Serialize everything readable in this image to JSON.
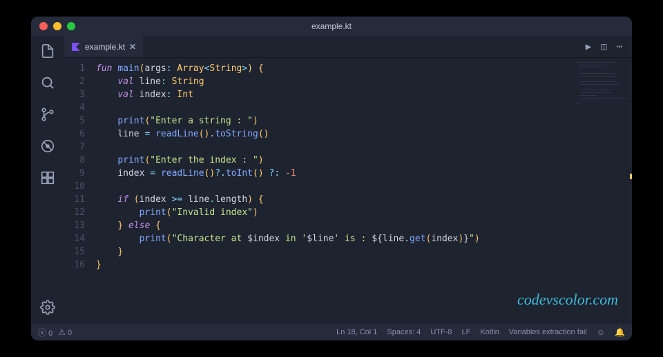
{
  "window": {
    "title": "example.kt"
  },
  "tab": {
    "filename": "example.kt"
  },
  "code": {
    "lines": [
      {
        "n": "1",
        "seg": [
          {
            "c": "kw",
            "t": "fun "
          },
          {
            "c": "fn",
            "t": "main"
          },
          {
            "c": "pn",
            "t": "("
          },
          {
            "c": "id",
            "t": "args"
          },
          {
            "c": "op",
            "t": ": "
          },
          {
            "c": "ty",
            "t": "Array"
          },
          {
            "c": "op",
            "t": "<"
          },
          {
            "c": "ty",
            "t": "String"
          },
          {
            "c": "op",
            "t": ">"
          },
          {
            "c": "pn",
            "t": ") {"
          }
        ]
      },
      {
        "n": "2",
        "seg": [
          {
            "c": "",
            "t": "    "
          },
          {
            "c": "kw",
            "t": "val "
          },
          {
            "c": "id",
            "t": "line"
          },
          {
            "c": "op",
            "t": ": "
          },
          {
            "c": "ty",
            "t": "String"
          }
        ]
      },
      {
        "n": "3",
        "seg": [
          {
            "c": "",
            "t": "    "
          },
          {
            "c": "kw",
            "t": "val "
          },
          {
            "c": "id",
            "t": "index"
          },
          {
            "c": "op",
            "t": ": "
          },
          {
            "c": "ty",
            "t": "Int"
          }
        ]
      },
      {
        "n": "4",
        "seg": []
      },
      {
        "n": "5",
        "seg": [
          {
            "c": "",
            "t": "    "
          },
          {
            "c": "fn",
            "t": "print"
          },
          {
            "c": "pn",
            "t": "("
          },
          {
            "c": "str",
            "t": "\"Enter a string : \""
          },
          {
            "c": "pn",
            "t": ")"
          }
        ]
      },
      {
        "n": "6",
        "seg": [
          {
            "c": "",
            "t": "    "
          },
          {
            "c": "id",
            "t": "line "
          },
          {
            "c": "op",
            "t": "= "
          },
          {
            "c": "fn",
            "t": "readLine"
          },
          {
            "c": "pn",
            "t": "()"
          },
          {
            "c": "op",
            "t": "."
          },
          {
            "c": "fn",
            "t": "toString"
          },
          {
            "c": "pn",
            "t": "()"
          }
        ]
      },
      {
        "n": "7",
        "seg": []
      },
      {
        "n": "8",
        "seg": [
          {
            "c": "",
            "t": "    "
          },
          {
            "c": "fn",
            "t": "print"
          },
          {
            "c": "pn",
            "t": "("
          },
          {
            "c": "str",
            "t": "\"Enter the index : \""
          },
          {
            "c": "pn",
            "t": ")"
          }
        ]
      },
      {
        "n": "9",
        "seg": [
          {
            "c": "",
            "t": "    "
          },
          {
            "c": "id",
            "t": "index "
          },
          {
            "c": "op",
            "t": "= "
          },
          {
            "c": "fn",
            "t": "readLine"
          },
          {
            "c": "pn",
            "t": "()"
          },
          {
            "c": "op",
            "t": "?."
          },
          {
            "c": "fn",
            "t": "toInt"
          },
          {
            "c": "pn",
            "t": "() "
          },
          {
            "c": "op",
            "t": "?: "
          },
          {
            "c": "num",
            "t": "-1"
          }
        ]
      },
      {
        "n": "10",
        "seg": []
      },
      {
        "n": "11",
        "seg": [
          {
            "c": "",
            "t": "    "
          },
          {
            "c": "kw",
            "t": "if "
          },
          {
            "c": "pn",
            "t": "("
          },
          {
            "c": "id",
            "t": "index "
          },
          {
            "c": "op",
            "t": ">= "
          },
          {
            "c": "id",
            "t": "line"
          },
          {
            "c": "op",
            "t": "."
          },
          {
            "c": "id",
            "t": "length"
          },
          {
            "c": "pn",
            "t": ") {"
          }
        ]
      },
      {
        "n": "12",
        "seg": [
          {
            "c": "",
            "t": "        "
          },
          {
            "c": "fn",
            "t": "print"
          },
          {
            "c": "pn",
            "t": "("
          },
          {
            "c": "str",
            "t": "\"Invalid index\""
          },
          {
            "c": "pn",
            "t": ")"
          }
        ]
      },
      {
        "n": "13",
        "seg": [
          {
            "c": "",
            "t": "    "
          },
          {
            "c": "pn",
            "t": "} "
          },
          {
            "c": "kw",
            "t": "else "
          },
          {
            "c": "pn",
            "t": "{"
          }
        ]
      },
      {
        "n": "14",
        "seg": [
          {
            "c": "",
            "t": "        "
          },
          {
            "c": "fn",
            "t": "print"
          },
          {
            "c": "pn",
            "t": "("
          },
          {
            "c": "str",
            "t": "\"Character at "
          },
          {
            "c": "interp",
            "t": "$index"
          },
          {
            "c": "str",
            "t": " in '"
          },
          {
            "c": "interp",
            "t": "$line"
          },
          {
            "c": "str",
            "t": "' is : "
          },
          {
            "c": "interp",
            "t": "${"
          },
          {
            "c": "id",
            "t": "line"
          },
          {
            "c": "op",
            "t": "."
          },
          {
            "c": "fn",
            "t": "get"
          },
          {
            "c": "pn",
            "t": "("
          },
          {
            "c": "id",
            "t": "index"
          },
          {
            "c": "pn",
            "t": ")"
          },
          {
            "c": "interp",
            "t": "}"
          },
          {
            "c": "str",
            "t": "\""
          },
          {
            "c": "pn",
            "t": ")"
          }
        ]
      },
      {
        "n": "15",
        "seg": [
          {
            "c": "",
            "t": "    "
          },
          {
            "c": "pn",
            "t": "}"
          }
        ]
      },
      {
        "n": "16",
        "seg": [
          {
            "c": "pn",
            "t": "}"
          }
        ]
      }
    ]
  },
  "status": {
    "errors": "0",
    "warnings": "0",
    "position": "Ln 18, Col 1",
    "spaces": "Spaces: 4",
    "encoding": "UTF-8",
    "eol": "LF",
    "language": "Kotlin",
    "extra": "Variables extraction fail"
  },
  "watermark": "codevscolor.com"
}
